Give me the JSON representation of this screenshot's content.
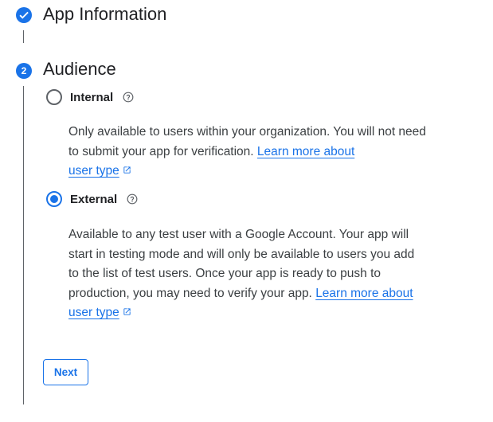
{
  "step1": {
    "title": "App Information",
    "status": "completed",
    "icon": "check-icon"
  },
  "step2": {
    "number": "2",
    "title": "Audience",
    "options": {
      "internal": {
        "label": "Internal",
        "selected": false,
        "description": "Only available to users within your organization. You will not need to submit your app for verification. ",
        "link_text_1": "Learn more about",
        "link_text_2": "user type"
      },
      "external": {
        "label": "External",
        "selected": true,
        "description": "Available to any test user with a Google Account. Your app will start in testing mode and will only be available to users you add to the list of test users. Once your app is ready to push to production, you may need to verify your app. ",
        "link_text_1": "Learn more about",
        "link_text_2": "user type"
      }
    },
    "next_label": "Next"
  },
  "colors": {
    "accent": "#1a73e8",
    "text": "#202124",
    "secondary_text": "#3c4043",
    "connector": "#5f6368"
  }
}
